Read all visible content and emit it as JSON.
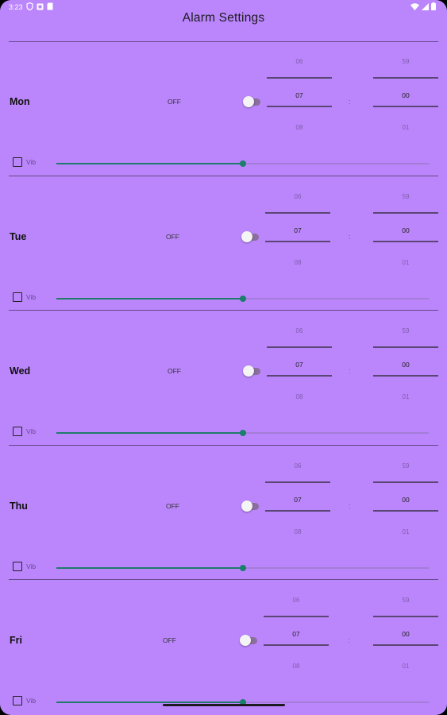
{
  "status_bar": {
    "time": "3:23",
    "icons_left": [
      "vpn-shield-icon",
      "notification-icon",
      "sd-card-icon"
    ],
    "icons_right": [
      "wifi-icon",
      "signal-icon",
      "battery-icon"
    ]
  },
  "app": {
    "title": "Alarm Settings",
    "colors": {
      "background": "#bb86fc",
      "slider_accent": "#1a7f6c",
      "divider": "#5a4674"
    }
  },
  "days": [
    {
      "label": "Mon",
      "state": "OFF",
      "enabled": false,
      "hour": {
        "prev": "06",
        "current": "07",
        "next": "08"
      },
      "minute": {
        "prev": "59",
        "current": "00",
        "next": "01"
      },
      "separator": ":",
      "vibrate_label": "Vib",
      "vibrate": false,
      "volume": 0.5
    },
    {
      "label": "Tue",
      "state": "OFF",
      "enabled": false,
      "hour": {
        "prev": "06",
        "current": "07",
        "next": "08"
      },
      "minute": {
        "prev": "59",
        "current": "00",
        "next": "01"
      },
      "separator": ":",
      "vibrate_label": "Vib",
      "vibrate": false,
      "volume": 0.5
    },
    {
      "label": "Wed",
      "state": "OFF",
      "enabled": false,
      "hour": {
        "prev": "06",
        "current": "07",
        "next": "08"
      },
      "minute": {
        "prev": "59",
        "current": "00",
        "next": "01"
      },
      "separator": ":",
      "vibrate_label": "Vib",
      "vibrate": false,
      "volume": 0.5
    },
    {
      "label": "Thu",
      "state": "OFF",
      "enabled": false,
      "hour": {
        "prev": "06",
        "current": "07",
        "next": "08"
      },
      "minute": {
        "prev": "59",
        "current": "00",
        "next": "01"
      },
      "separator": ":",
      "vibrate_label": "Vib",
      "vibrate": false,
      "volume": 0.5
    },
    {
      "label": "Fri",
      "state": "OFF",
      "enabled": false,
      "hour": {
        "prev": "06",
        "current": "07",
        "next": "08"
      },
      "minute": {
        "prev": "59",
        "current": "00",
        "next": "01"
      },
      "separator": ":",
      "vibrate_label": "Vib",
      "vibrate": false,
      "volume": 0.5
    }
  ]
}
